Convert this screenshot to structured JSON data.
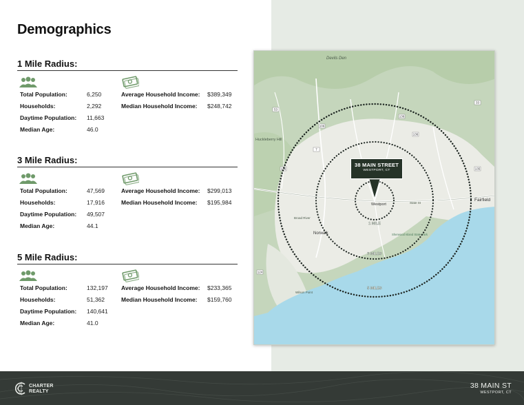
{
  "page": {
    "title": "Demographics"
  },
  "sections": [
    {
      "title": "1 Mile Radius:",
      "stats": [
        {
          "label": "Total Population:",
          "value": "6,250"
        },
        {
          "label": "Households:",
          "value": "2,292"
        },
        {
          "label": "Daytime Population:",
          "value": "11,663"
        },
        {
          "label": "Median Age:",
          "value": "46.0"
        }
      ],
      "income": [
        {
          "label": "Average Household Income:",
          "value": "$389,349"
        },
        {
          "label": "Median Household Income:",
          "value": "$248,742"
        }
      ]
    },
    {
      "title": "3 Mile Radius:",
      "stats": [
        {
          "label": "Total Population:",
          "value": "47,569"
        },
        {
          "label": "Households:",
          "value": "17,916"
        },
        {
          "label": "Daytime Population:",
          "value": "49,507"
        },
        {
          "label": "Median Age:",
          "value": "44.1"
        }
      ],
      "income": [
        {
          "label": "Average Household Income:",
          "value": "$299,013"
        },
        {
          "label": "Median Household Income:",
          "value": "$195,984"
        }
      ]
    },
    {
      "title": "5 Mile Radius:",
      "stats": [
        {
          "label": "Total Population:",
          "value": "132,197"
        },
        {
          "label": "Households:",
          "value": "51,362"
        },
        {
          "label": "Daytime Population:",
          "value": "140,641"
        },
        {
          "label": "Median Age:",
          "value": "41.0"
        }
      ],
      "income": [
        {
          "label": "Average Household Income:",
          "value": "$233,365"
        },
        {
          "label": "Median Household Income:",
          "value": "$159,760"
        }
      ]
    }
  ],
  "map": {
    "callout_title": "38 MAIN STREET",
    "callout_subtitle": "WESTPORT, CT",
    "ring_labels": [
      "1 MILE",
      "3 MILES",
      "5 MILES"
    ],
    "places": {
      "devils_den": "Devils Den",
      "huckleberry_hill": "Huckleberry Hill",
      "westport": "Westport",
      "norwalk": "Norwalk",
      "fairfield": "Fairfield",
      "broad_river": "Broad River",
      "sherwood_island": "Sherwood Island State Park",
      "state_st": "State St",
      "wilson_point": "Wilson Point"
    },
    "route_shields": [
      "53",
      "136",
      "106",
      "7",
      "33",
      "136",
      "135",
      "124",
      "136"
    ],
    "colors": {
      "water": "#a8d9ea",
      "land_green": "#c5d6bc",
      "urban": "#eeeeea",
      "ring_dots": "#1d2521"
    }
  },
  "footer": {
    "brand_line1": "CHARTER",
    "brand_line2": "REALTY",
    "address_main": "38 MAIN ST",
    "address_sub": "WESTPORT, CT"
  },
  "icons": {
    "population": "people-group-icon",
    "income": "money-stack-icon",
    "logo": "charter-realty-logo-icon"
  },
  "colors": {
    "icon_green": "#6f9a6a",
    "footer_bg": "#343a36",
    "right_panel_bg": "#e6ebe5"
  }
}
